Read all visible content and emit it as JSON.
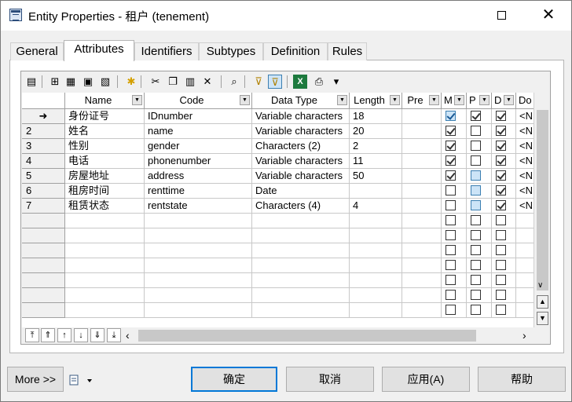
{
  "window": {
    "title": "Entity Properties - 租户 (tenement)",
    "maximize_glyph": "□",
    "close_glyph": "✕"
  },
  "tabs": [
    {
      "label": "General",
      "active": false
    },
    {
      "label": "Attributes",
      "active": true
    },
    {
      "label": "Identifiers",
      "active": false
    },
    {
      "label": "Subtypes",
      "active": false
    },
    {
      "label": "Definition",
      "active": false
    },
    {
      "label": "Rules",
      "active": false
    }
  ],
  "toolbar": {
    "icons": [
      "properties-icon",
      "insert-row-icon",
      "add-row-icon",
      "add-attributes-icon",
      "reuse-icon",
      "key-icon",
      "cut-icon",
      "copy-icon",
      "paste-icon",
      "delete-icon",
      "find-icon",
      "filter-icon",
      "filter-active-icon",
      "excel-icon",
      "print-icon",
      "dropdown-icon"
    ]
  },
  "grid": {
    "columns": [
      {
        "label": "Name"
      },
      {
        "label": "Code"
      },
      {
        "label": "Data Type"
      },
      {
        "label": "Length"
      },
      {
        "label": "Pre"
      },
      {
        "label": "M"
      },
      {
        "label": "P"
      },
      {
        "label": "D"
      },
      {
        "label": "Do"
      }
    ],
    "current_row_marker": "➜",
    "rows": [
      {
        "num": "",
        "name": "身份证号",
        "code": "IDnumber",
        "type": "Variable characters",
        "length": "18",
        "pre": "",
        "m": true,
        "p": true,
        "d": true,
        "do": "<N"
      },
      {
        "num": "2",
        "name": "姓名",
        "code": "name",
        "type": "Variable characters",
        "length": "20",
        "pre": "",
        "m": true,
        "p": false,
        "d": true,
        "do": "<N"
      },
      {
        "num": "3",
        "name": "性别",
        "code": "gender",
        "type": "Characters (2)",
        "length": "2",
        "pre": "",
        "m": true,
        "p": false,
        "d": true,
        "do": "<N"
      },
      {
        "num": "4",
        "name": "电话",
        "code": "phonenumber",
        "type": "Variable characters",
        "length": "11",
        "pre": "",
        "m": true,
        "p": false,
        "d": true,
        "do": "<N"
      },
      {
        "num": "5",
        "name": "房屋地址",
        "code": "address",
        "type": "Variable characters",
        "length": "50",
        "pre": "",
        "m": true,
        "p": false,
        "d": true,
        "do": "<N"
      },
      {
        "num": "6",
        "name": "租房时间",
        "code": "renttime",
        "type": "Date",
        "length": "",
        "pre": "",
        "m": false,
        "p": false,
        "d": true,
        "do": "<N"
      },
      {
        "num": "7",
        "name": "租赁状态",
        "code": "rentstate",
        "type": "Characters (4)",
        "length": "4",
        "pre": "",
        "m": false,
        "p": false,
        "d": true,
        "do": "<N"
      }
    ],
    "empty_rows": 7
  },
  "footer": {
    "more_label": "More >>",
    "ok_label": "确定",
    "cancel_label": "取消",
    "apply_label": "应用(A)",
    "help_label": "帮助"
  }
}
